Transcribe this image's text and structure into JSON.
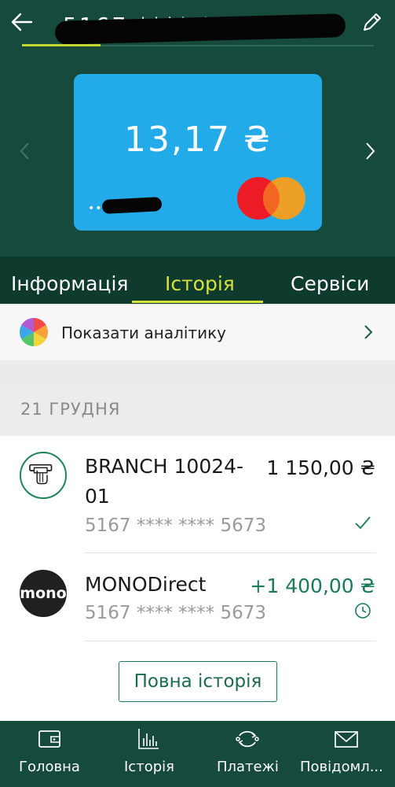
{
  "header": {
    "card_title": "5167 **** **** 5673",
    "balance": "13,17 ₴",
    "card_dots": "••••"
  },
  "tabs": [
    {
      "label": "Інформація",
      "active": false
    },
    {
      "label": "Історія",
      "active": true
    },
    {
      "label": "Сервіси",
      "active": false
    }
  ],
  "analytics": {
    "label": "Показати аналітику"
  },
  "date_header": "21 ГРУДНЯ",
  "transactions": [
    {
      "name_line1": "BRANCH 10024-",
      "name_line2": "01",
      "amount": "1 150,00 ₴",
      "card": "5167 **** **** 5673",
      "status": "completed"
    },
    {
      "name_line1": "MONODirect",
      "name_line2": "",
      "amount": "+1 400,00 ₴",
      "card": "5167 **** **** 5673",
      "status": "pending",
      "icon_text": "mono"
    }
  ],
  "full_history_label": "Повна історія",
  "bottom_nav": [
    {
      "label": "Головна",
      "icon": "wallet-icon"
    },
    {
      "label": "Історія",
      "icon": "chart-icon"
    },
    {
      "label": "Платежі",
      "icon": "transfer-icon"
    },
    {
      "label": "Повідомл...",
      "icon": "mail-icon"
    }
  ],
  "colors": {
    "header_bg": "#154a3c",
    "tabs_bg": "#0f3b2f",
    "accent": "#d7e23a",
    "card_bg": "#22abe8",
    "positive": "#1b7a58"
  }
}
